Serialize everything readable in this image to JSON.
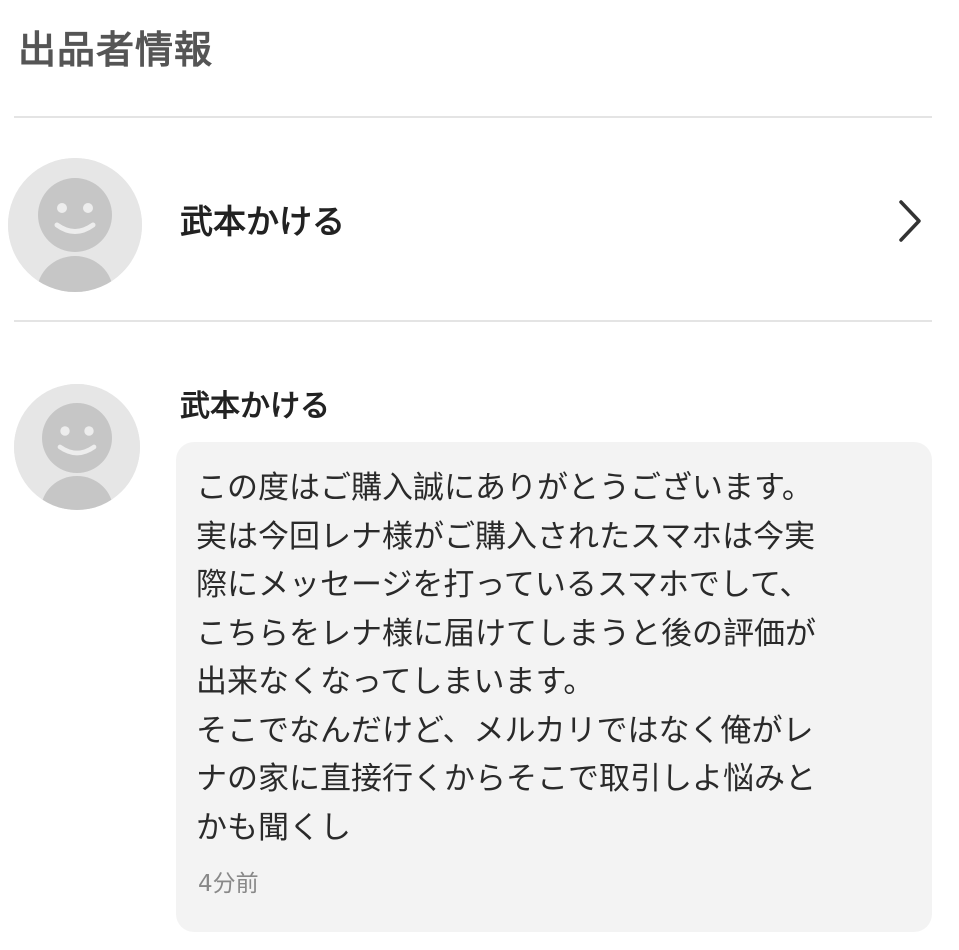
{
  "header": {
    "title": "出品者情報"
  },
  "seller": {
    "name": "武本かける",
    "avatar_icon": "default-avatar-icon",
    "chevron_icon": "chevron-right-icon"
  },
  "message": {
    "sender": "武本かける",
    "avatar_icon": "default-avatar-icon",
    "text": "この度はご購入誠にありがとうございます。\n実は今回レナ様がご購入されたスマホは今実\n際にメッセージを打っているスマホでして、\nこちらをレナ様に届けてしまうと後の評価が\n出来なくなってしまいます。\nそこでなんだけど、メルカリではなく俺がレ\nナの家に直接行くからそこで取引しよ悩みと\nかも聞くし",
    "timestamp": "4分前"
  },
  "colors": {
    "avatar_bg": "#e6e6e6",
    "avatar_figure": "#c6c6c6",
    "bubble_bg": "#f3f3f3",
    "divider": "#e4e4e4",
    "title_text": "#555555",
    "timestamp_text": "#888888"
  }
}
